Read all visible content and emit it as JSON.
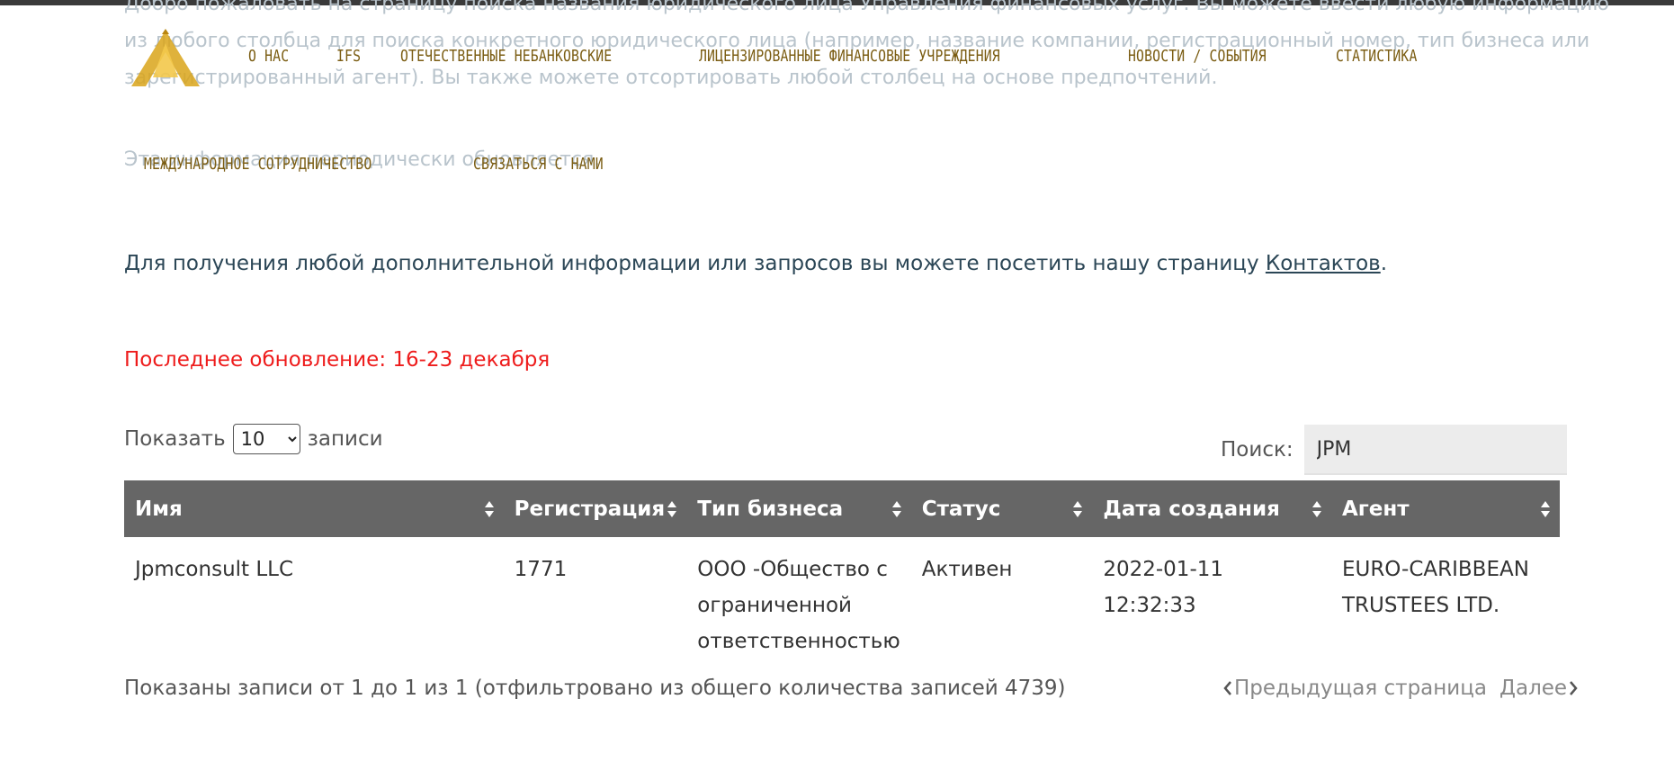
{
  "intro": {
    "line1": "Добро пожаловать на страницу поиска названия юридического лица Управления финансовых услуг. Вы можете ввести любую информацию",
    "line2": "из любого столбца для поиска конкретного юридического лица (например, название компании, регистрационный номер, тип бизнеса или",
    "line3": "зарегистрированный агент). Вы также можете отсортировать любой столбец на основе предпочтений.",
    "line4": "Эта информация периодически обновляется."
  },
  "nav": {
    "about": "О НАС",
    "ifs": "IFS",
    "domestic": "ОТЕЧЕСТВЕННЫЕ НЕБАНКОВСКИЕ",
    "licensed": "ЛИЦЕНЗИРОВАННЫЕ ФИНАНСОВЫЕ УЧРЕЖДЕНИЯ",
    "news": "НОВОСТИ / СОБЫТИЯ",
    "stats": "СТАТИСТИКА",
    "intl": "МЕЖДУНАРОДНОЕ СОТРУДНИЧЕСТВО",
    "contact": "СВЯЗАТЬСЯ С НАМИ"
  },
  "contact_line": {
    "text": "Для получения любой дополнительной информации или запросов вы можете посетить нашу страницу ",
    "link": "Контактов",
    "end": "."
  },
  "updated": "Последнее обновление: 16-23 декабря",
  "length": {
    "before": "Показать",
    "value": "10",
    "after": "записи",
    "options": [
      "10"
    ]
  },
  "search": {
    "label": "Поиск:",
    "value": "JPM"
  },
  "table": {
    "headers": {
      "name": "Имя",
      "reg": "Регистрация",
      "type": "Тип бизнеса",
      "status": "Статус",
      "created": "Дата создания",
      "agent": "Агент"
    },
    "rows": [
      {
        "name": "Jpmconsult LLC",
        "reg": "1771",
        "type": "ООО -Общество с ограниченной ответственностью",
        "status": "Активен",
        "created": "2022-01-11 12:32:33",
        "agent": "EURO-CARIBBEAN TRUSTEES LTD."
      }
    ]
  },
  "info": "Показаны записи от 1 до 1 из 1 (отфильтровано из общего количества записей 4739)",
  "pager": {
    "prev": "Предыдущая страница",
    "next": "Далее"
  },
  "colors": {
    "nav": "#7b5d13",
    "header_bg": "#666666",
    "updated": "#ee1c1c",
    "logo": "#d9a51a"
  }
}
